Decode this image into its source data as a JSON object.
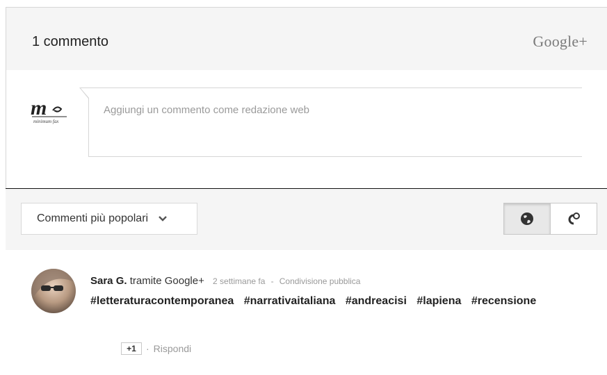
{
  "header": {
    "count_label": "1 commento",
    "brand": "Google+"
  },
  "composer": {
    "placeholder": "Aggiungi un commento come redazione web",
    "logo_text": "minimum fax"
  },
  "toolbar": {
    "sort_label": "Commenti più popolari",
    "toggle": [
      {
        "icon": "globe-icon",
        "active": true
      },
      {
        "icon": "link-circles-icon",
        "active": false
      }
    ]
  },
  "comments": [
    {
      "author": "Sara G.",
      "via": "tramite Google+",
      "time": "2 settimane fa",
      "sep": "-",
      "visibility": "Condivisione pubblica",
      "tags": [
        "#letteraturacontemporanea",
        "#narrativaitaliana",
        "#andreacisi",
        "#lapiena",
        "#recensione"
      ],
      "plus_label": "+1",
      "dot": "·",
      "reply_label": "Rispondi"
    }
  ]
}
